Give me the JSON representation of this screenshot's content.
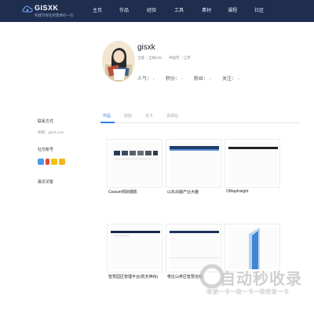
{
  "header": {
    "brand": "GISXK",
    "slogan": "构建可视化所需要的一切",
    "nav": [
      "主页",
      "作品",
      "经验",
      "工具",
      "素材",
      "课程",
      "社区"
    ]
  },
  "profile": {
    "username": "gisxk",
    "meta": [
      "全能",
      "全栈GIS",
      "中国市",
      "江苏"
    ],
    "stats": [
      {
        "label": "人气：",
        "value": "-"
      },
      {
        "label": "积分：",
        "value": "-"
      },
      {
        "label": "粉丝：",
        "value": "-"
      },
      {
        "label": "关注：",
        "value": "-"
      }
    ]
  },
  "sidebar": {
    "contact_title": "联系方式",
    "contact_value": "邮箱：gisxk.com",
    "social_title": "社交账号",
    "recent_title": "最近访客"
  },
  "tabs": [
    "作品",
    "经验",
    "关卡",
    "资源站"
  ],
  "cards": [
    {
      "title": "Cesium倾斜摄影"
    },
    {
      "title": "山东出版产业大脑"
    },
    {
      "title": "OMapInsight"
    },
    {
      "title": "智慧园区管理平台(凯天神舟)"
    },
    {
      "title": "枣庄山亭区智慧治理"
    },
    {
      "title": ""
    }
  ],
  "watermark": {
    "title": "自动秒收录",
    "subtitle": "收录一卡一收一卡一收收录一卡"
  },
  "colors": {
    "header_bg": "#1f2d4f",
    "accent": "#2f80ed"
  }
}
